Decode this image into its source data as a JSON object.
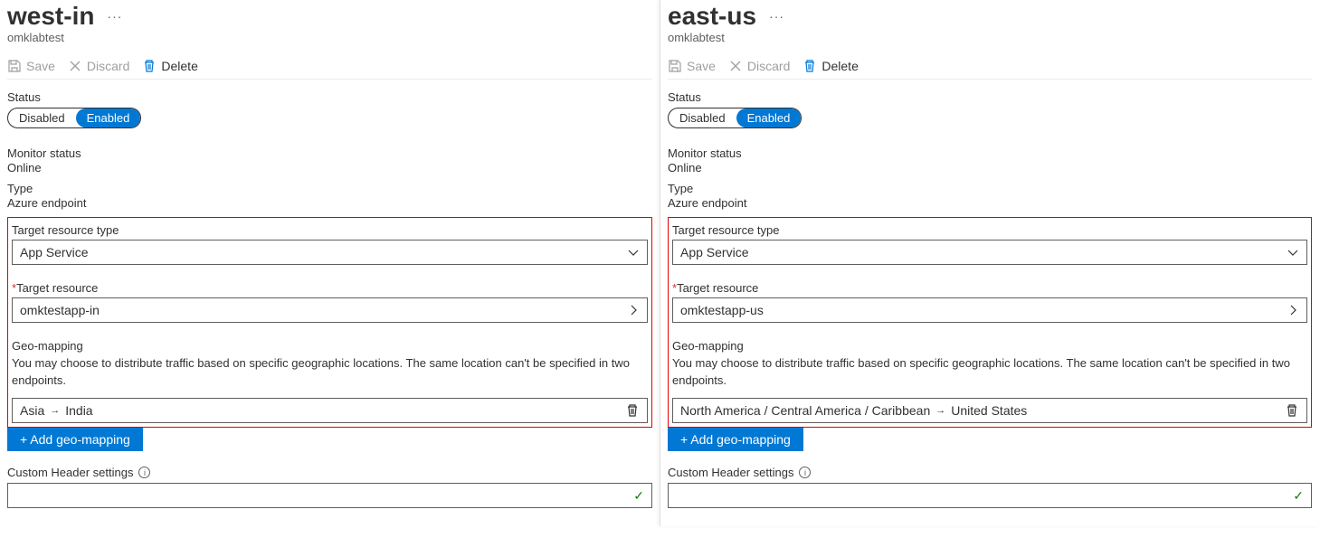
{
  "toolbar": {
    "save": "Save",
    "discard": "Discard",
    "delete": "Delete"
  },
  "labels": {
    "status": "Status",
    "disabled": "Disabled",
    "enabled": "Enabled",
    "monitor_status": "Monitor status",
    "type": "Type",
    "target_resource_type": "Target resource type",
    "target_resource": "Target resource",
    "geo_mapping": "Geo-mapping",
    "geo_desc": "You may choose to distribute traffic based on specific geographic locations. The same location can't be specified in two endpoints.",
    "add_geo": "+ Add geo-mapping",
    "custom_header": "Custom Header settings"
  },
  "left": {
    "title": "west-in",
    "subtitle": "omklabtest",
    "monitor_status_value": "Online",
    "type_value": "Azure endpoint",
    "target_resource_type_value": "App Service",
    "target_resource_value": "omktestapp-in",
    "geo_region_parent": "Asia",
    "geo_region_child": "India"
  },
  "right": {
    "title": "east-us",
    "subtitle": "omklabtest",
    "monitor_status_value": "Online",
    "type_value": "Azure endpoint",
    "target_resource_type_value": "App Service",
    "target_resource_value": "omktestapp-us",
    "geo_region_parent": "North America / Central America / Caribbean",
    "geo_region_child": "United States"
  }
}
